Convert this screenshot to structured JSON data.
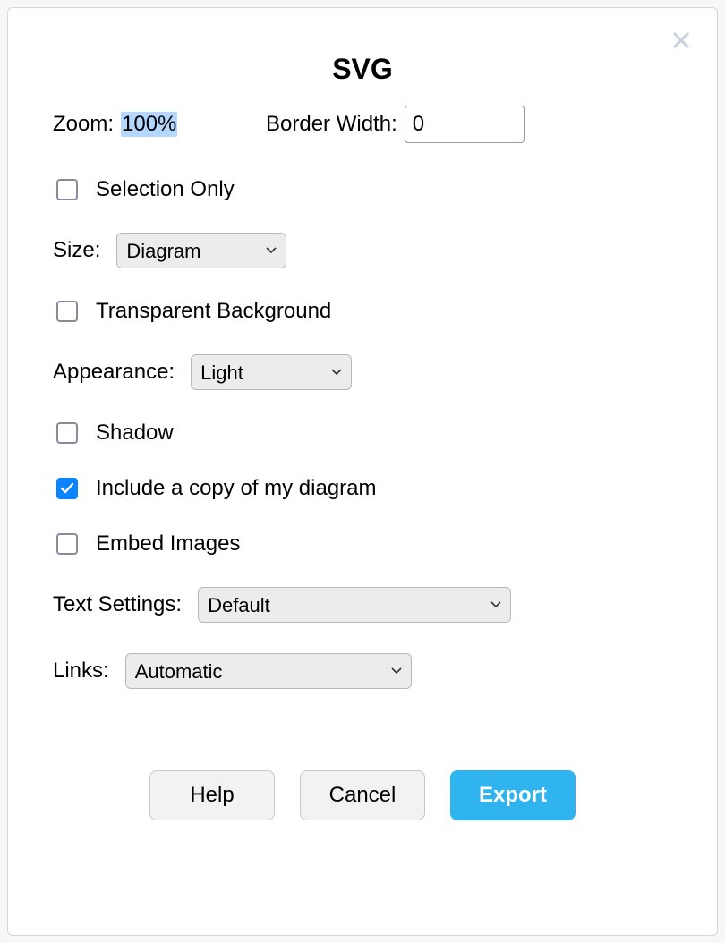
{
  "dialog": {
    "title": "SVG",
    "close_icon": "close-icon"
  },
  "zoom": {
    "label": "Zoom:",
    "value": "100%"
  },
  "border_width": {
    "label": "Border Width:",
    "value": "0"
  },
  "selection_only": {
    "label": "Selection Only",
    "checked": false
  },
  "size": {
    "label": "Size:",
    "value": "Diagram"
  },
  "transparent_bg": {
    "label": "Transparent Background",
    "checked": false
  },
  "appearance": {
    "label": "Appearance:",
    "value": "Light"
  },
  "shadow": {
    "label": "Shadow",
    "checked": false
  },
  "include_copy": {
    "label": "Include a copy of my diagram",
    "checked": true
  },
  "embed_images": {
    "label": "Embed Images",
    "checked": false
  },
  "text_settings": {
    "label": "Text Settings:",
    "value": "Default"
  },
  "links": {
    "label": "Links:",
    "value": "Automatic"
  },
  "buttons": {
    "help": "Help",
    "cancel": "Cancel",
    "export": "Export"
  }
}
